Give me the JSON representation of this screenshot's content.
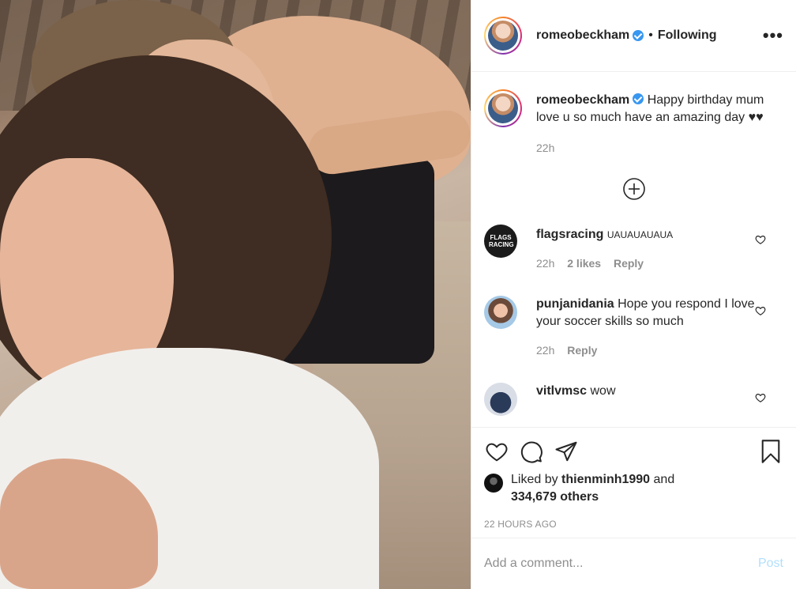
{
  "post": {
    "username": "romeobeckham",
    "separator": "•",
    "follow_status": "Following",
    "more_label": "•••",
    "photo_alt": ""
  },
  "caption": {
    "username": "romeobeckham",
    "text": "Happy birthday mum love u so much have an amazing day ♥♥",
    "time": "22h"
  },
  "comments": [
    {
      "username": "flagsracing",
      "text": "UAUAUAUAUA",
      "time": "22h",
      "likes": "2 likes",
      "reply": "Reply",
      "avatar_text": "FLAGS RACING"
    },
    {
      "username": "punjanidania",
      "text": "Hope you respond I love your soccer skills so much",
      "time": "22h",
      "reply": "Reply"
    },
    {
      "username": "vitlvmsc",
      "text": "wow"
    }
  ],
  "likes": {
    "prefix": "Liked by",
    "user": "thienminh1990",
    "and": "and",
    "others": "334,679 others"
  },
  "timestamp": "22 HOURS AGO",
  "add_comment": {
    "placeholder": "Add a comment...",
    "post_label": "Post"
  },
  "colors": {
    "verified": "#3897f0",
    "post_disabled": "#b2dffc",
    "muted": "#8e8e8e",
    "text": "#262626"
  }
}
